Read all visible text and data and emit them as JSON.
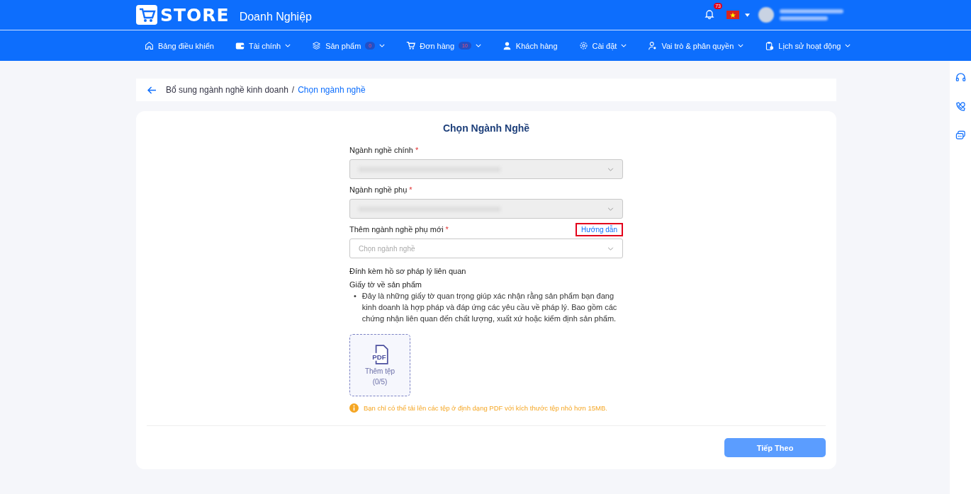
{
  "header": {
    "logo_text": "STORE",
    "subtitle": "Doanh Nghiệp",
    "notification_count": "73"
  },
  "nav": [
    {
      "label": "Bảng điều khiển",
      "kind": "home",
      "dropdown": false
    },
    {
      "label": "Tài chính",
      "kind": "wallet",
      "dropdown": true
    },
    {
      "label": "Sản phẩm",
      "kind": "layers",
      "dropdown": true,
      "badge": "0"
    },
    {
      "label": "Đơn hàng",
      "kind": "cart",
      "dropdown": true,
      "badge": "10"
    },
    {
      "label": "Khách hàng",
      "kind": "user",
      "dropdown": false
    },
    {
      "label": "Cài đặt",
      "kind": "gear",
      "dropdown": true
    },
    {
      "label": "Vai trò & phân quyền",
      "kind": "usergear",
      "dropdown": true
    },
    {
      "label": "Lịch sử hoạt động",
      "kind": "clipboard",
      "dropdown": true
    }
  ],
  "breadcrumb": {
    "parent": "Bổ sung ngành nghề kinh doanh",
    "separator": "/",
    "current": "Chọn ngành nghề"
  },
  "form": {
    "title": "Chọn Ngành Nghề",
    "fields": [
      {
        "label": "Ngành nghề chính",
        "required_mark": "*",
        "disabled": true,
        "redacted": true
      },
      {
        "label": "Ngành nghề phụ",
        "required_mark": "*",
        "disabled": true,
        "redacted": true
      },
      {
        "label": "Thêm ngành nghề phụ mới",
        "required_mark": "*",
        "disabled": false,
        "placeholder": "Chọn ngành nghề",
        "link": {
          "label": "Hướng dẫn",
          "highlighted": true
        }
      }
    ],
    "attach_title": "Đính kèm hồ sơ pháp lý liên quan",
    "doc_title": "Giấy tờ về sản phẩm",
    "bullet_marker": "•",
    "bullets": [
      "Đây là những giấy tờ quan trọng giúp xác nhận rằng sản phẩm bạn đang kinh doanh là hợp pháp và đáp ứng các yêu cầu về pháp lý. Bao gồm các chứng nhận liên quan đến chất lượng, xuất xứ hoặc kiểm định sản phẩm."
    ],
    "upload": {
      "icon_text": "PDF",
      "label": "Thêm tệp",
      "count": "(0/5)"
    },
    "note": "Bạn chỉ có thể tải lên các tệp ở định dạng PDF với kích thước tệp nhỏ hơn 15MB.",
    "submit": {
      "label": "Tiếp Theo",
      "disabled": true
    }
  }
}
